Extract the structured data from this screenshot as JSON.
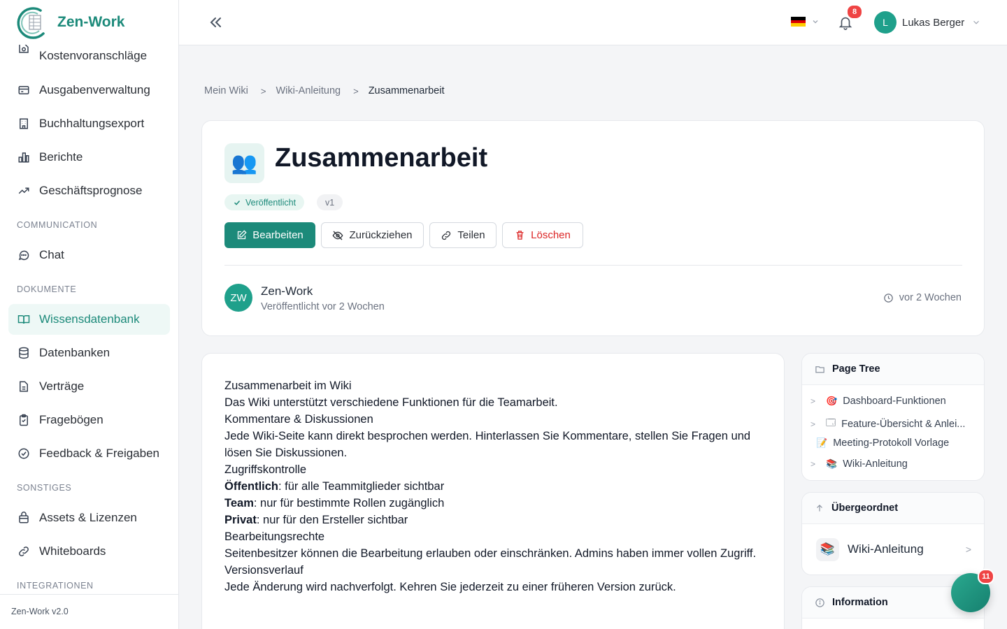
{
  "app": {
    "name": "Zen-Work",
    "version": "Zen-Work v2.0"
  },
  "sidebar": {
    "items": [
      {
        "label": "Kostenvoranschläge",
        "icon": "quote-icon"
      },
      {
        "label": "Ausgabenverwaltung",
        "icon": "wallet-icon"
      },
      {
        "label": "Buchhaltungsexport",
        "icon": "building-icon"
      },
      {
        "label": "Berichte",
        "icon": "bar-chart-icon"
      },
      {
        "label": "Geschäftsprognose",
        "icon": "trend-up-icon"
      }
    ],
    "section_communication": "COMMUNICATION",
    "communication": [
      {
        "label": "Chat",
        "icon": "chat-icon"
      }
    ],
    "section_dokumente": "DOKUMENTE",
    "dokumente": [
      {
        "label": "Wissensdatenbank",
        "icon": "book-icon",
        "active": true
      },
      {
        "label": "Datenbanken",
        "icon": "database-icon"
      },
      {
        "label": "Verträge",
        "icon": "file-icon"
      },
      {
        "label": "Fragebögen",
        "icon": "clipboard-icon"
      },
      {
        "label": "Feedback & Freigaben",
        "icon": "check-circle-icon"
      }
    ],
    "section_sonstiges": "SONSTIGES",
    "sonstiges": [
      {
        "label": "Assets & Lizenzen",
        "icon": "package-icon"
      },
      {
        "label": "Whiteboards",
        "icon": "link-icon"
      }
    ],
    "section_integrationen": "INTEGRATIONEN"
  },
  "header": {
    "notifications_count": "8",
    "user_initial": "L",
    "user_name": "Lukas Berger",
    "flag_colors": [
      "#000000",
      "#dd0000",
      "#ffce00"
    ]
  },
  "breadcrumb": {
    "items": [
      "Mein Wiki",
      "Wiki-Anleitung"
    ],
    "current": "Zusammenarbeit"
  },
  "page": {
    "icon": "👥",
    "title": "Zusammenarbeit",
    "status": "Veröffentlicht",
    "version": "v1",
    "actions": {
      "edit": "Bearbeiten",
      "withdraw": "Zurückziehen",
      "share": "Teilen",
      "delete": "Löschen"
    },
    "author_initials": "ZW",
    "author": "Zen-Work",
    "published": "Veröffentlicht vor 2 Wochen",
    "updated": "vor 2 Wochen"
  },
  "content": {
    "l1": "Zusammenarbeit im Wiki",
    "l2": "Das Wiki unterstützt verschiedene Funktionen für die Teamarbeit.",
    "l3": "Kommentare & Diskussionen",
    "l4": "Jede Wiki-Seite kann direkt besprochen werden. Hinterlassen Sie Kommentare, stellen Sie Fragen und lösen Sie Diskussionen.",
    "l5": "Zugriffskontrolle",
    "l6_b": "Öffentlich",
    "l6": ": für alle Teammitglieder sichtbar",
    "l7_b": "Team",
    "l7": ": nur für bestimmte Rollen zugänglich",
    "l8_b": "Privat",
    "l8": ": nur für den Ersteller sichtbar",
    "l9": "Bearbeitungsrechte",
    "l10": "Seitenbesitzer können die Bearbeitung erlauben oder einschränken. Admins haben immer vollen Zugriff.",
    "l11": "Versionsverlauf",
    "l12": "Jede Änderung wird nachverfolgt. Kehren Sie jederzeit zu einer früheren Version zurück."
  },
  "page_tree": {
    "title": "Page Tree",
    "items": [
      {
        "label": "Dashboard-Funktionen",
        "icon": "🎯"
      },
      {
        "label": "Feature-Übersicht & Anlei...",
        "icon": "🗔"
      },
      {
        "label": "Meeting-Protokoll Vorlage",
        "icon": "📝"
      },
      {
        "label": "Wiki-Anleitung",
        "icon": "📚"
      }
    ]
  },
  "parent": {
    "title": "Übergeordnet",
    "label": "Wiki-Anleitung",
    "icon": "📚"
  },
  "information": {
    "title": "Information"
  },
  "fab": {
    "badge": "11"
  }
}
